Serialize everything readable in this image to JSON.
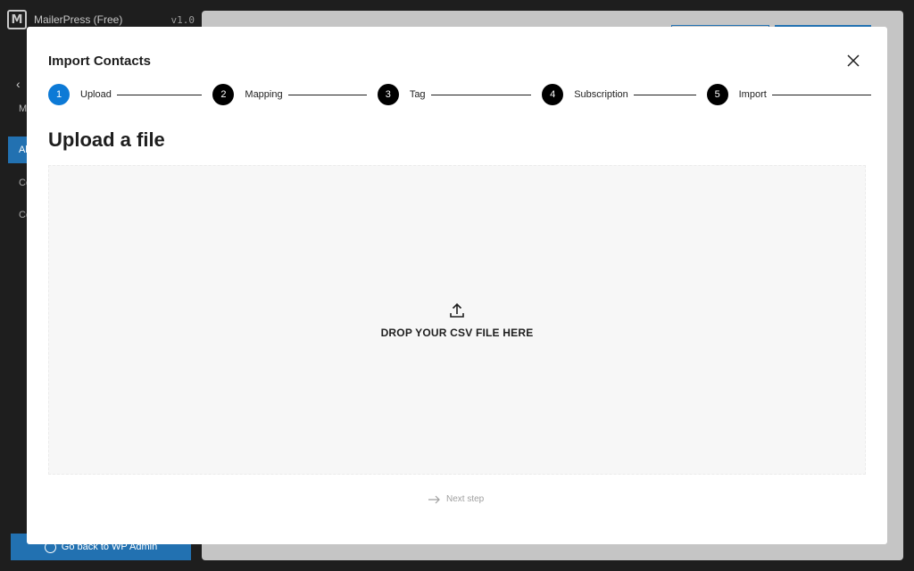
{
  "background_app": {
    "name": "MailerPress (Free)",
    "version": "v1.0",
    "logo_letter": "M",
    "back_arrow": "‹",
    "sidebar_heading": "M",
    "sidebar_active": "Al",
    "sidebar_links": [
      "Co",
      "Co"
    ],
    "bottom_button": "Go back to WP Admin",
    "accent_color": "#2271b1"
  },
  "modal": {
    "title": "Import Contacts",
    "close_icon": "close-icon",
    "steps": [
      {
        "number": "1",
        "label": "Upload",
        "active": true
      },
      {
        "number": "2",
        "label": "Mapping",
        "active": false
      },
      {
        "number": "3",
        "label": "Tag",
        "active": false
      },
      {
        "number": "4",
        "label": "Subscription",
        "active": false
      },
      {
        "number": "5",
        "label": "Import",
        "active": false
      }
    ],
    "active_step_color": "#0d7ad6",
    "section_title": "Upload a file",
    "dropzone": {
      "icon": "upload-icon",
      "text": "DROP YOUR CSV FILE HERE"
    },
    "next_step": {
      "icon": "arrow-right-icon",
      "label": "Next step"
    }
  }
}
